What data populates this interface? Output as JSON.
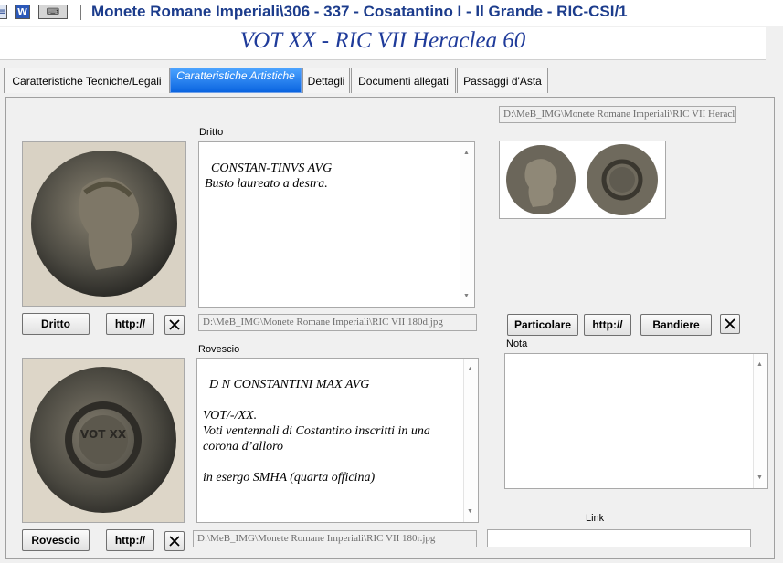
{
  "window": {
    "icons": [
      "form-icon",
      "word-icon",
      "keyboard-icon"
    ],
    "title": "Monete Romane Imperiali\\306 - 337 - Cosatantino I - Il Grande - RIC-CSI/1"
  },
  "header": {
    "coin_title": "VOT XX - RIC VII Heraclea 60"
  },
  "tabs": [
    {
      "label": "Caratteristiche Tecniche/Legali",
      "active": false
    },
    {
      "label": "Caratteristiche Artistiche",
      "active": true
    },
    {
      "label": "Dettagli",
      "active": false
    },
    {
      "label": "Documenti allegati",
      "active": false
    },
    {
      "label": "Passaggi d'Asta",
      "active": false
    }
  ],
  "dritto": {
    "label": "Dritto",
    "text": "CONSTAN-TINVS AVG\nBusto laureato a destra.",
    "path": "D:\\MeB_IMG\\Monete Romane Imperiali\\RIC VII 180d.jpg",
    "button": "Dritto",
    "http": "http://"
  },
  "rovescio": {
    "label": "Rovescio",
    "text": "D N CONSTANTINI MAX AVG\n\nVOT/-/XX.\nVoti ventennali di Costantino inscritti in una corona d’alloro\n\nin esergo SMHA (quarta officina)",
    "path": "D:\\MeB_IMG\\Monete Romane Imperiali\\RIC VII 180r.jpg",
    "button": "Rovescio",
    "http": "http://"
  },
  "particolare": {
    "path": "D:\\MeB_IMG\\Monete Romane Imperiali\\RIC VII Heraclea 60.jpg",
    "button": "Particolare",
    "http": "http://",
    "bandiere": "Bandiere"
  },
  "nota": {
    "label": "Nota",
    "value": ""
  },
  "link": {
    "label": "Link",
    "value": ""
  },
  "reverse_legend_letters": "VOT XX"
}
